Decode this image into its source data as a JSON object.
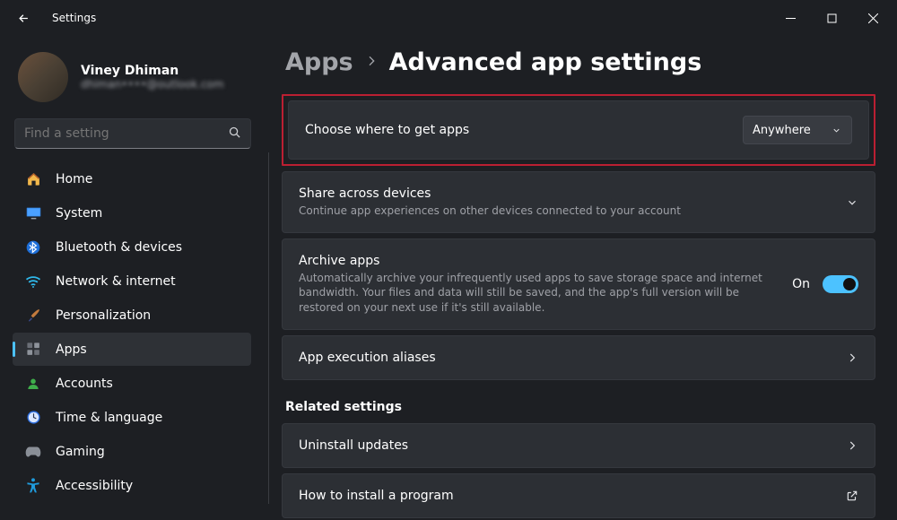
{
  "window": {
    "title": "Settings"
  },
  "profile": {
    "name": "Viney Dhiman",
    "email": "dhiman••••@outlook.com"
  },
  "search": {
    "placeholder": "Find a setting"
  },
  "nav": [
    {
      "id": "home",
      "label": "Home",
      "icon": "home-icon"
    },
    {
      "id": "system",
      "label": "System",
      "icon": "system-icon"
    },
    {
      "id": "bluetooth",
      "label": "Bluetooth & devices",
      "icon": "bluetooth-icon"
    },
    {
      "id": "network",
      "label": "Network & internet",
      "icon": "wifi-icon"
    },
    {
      "id": "personalization",
      "label": "Personalization",
      "icon": "paintbrush-icon"
    },
    {
      "id": "apps",
      "label": "Apps",
      "icon": "apps-icon",
      "active": true
    },
    {
      "id": "accounts",
      "label": "Accounts",
      "icon": "person-icon"
    },
    {
      "id": "time",
      "label": "Time & language",
      "icon": "clock-icon"
    },
    {
      "id": "gaming",
      "label": "Gaming",
      "icon": "gamepad-icon"
    },
    {
      "id": "accessibility",
      "label": "Accessibility",
      "icon": "accessibility-icon"
    }
  ],
  "breadcrumb": {
    "parent": "Apps",
    "current": "Advanced app settings"
  },
  "settings": {
    "choose_apps": {
      "title": "Choose where to get apps",
      "selected": "Anywhere"
    },
    "share_devices": {
      "title": "Share across devices",
      "sub": "Continue app experiences on other devices connected to your account"
    },
    "archive": {
      "title": "Archive apps",
      "sub": "Automatically archive your infrequently used apps to save storage space and internet bandwidth. Your files and data will still be saved, and the app's full version will be restored on your next use if it's still available.",
      "toggle_label": "On"
    },
    "aliases": {
      "title": "App execution aliases"
    }
  },
  "related": {
    "heading": "Related settings",
    "uninstall": {
      "title": "Uninstall updates"
    },
    "install_program": {
      "title": "How to install a program"
    }
  }
}
